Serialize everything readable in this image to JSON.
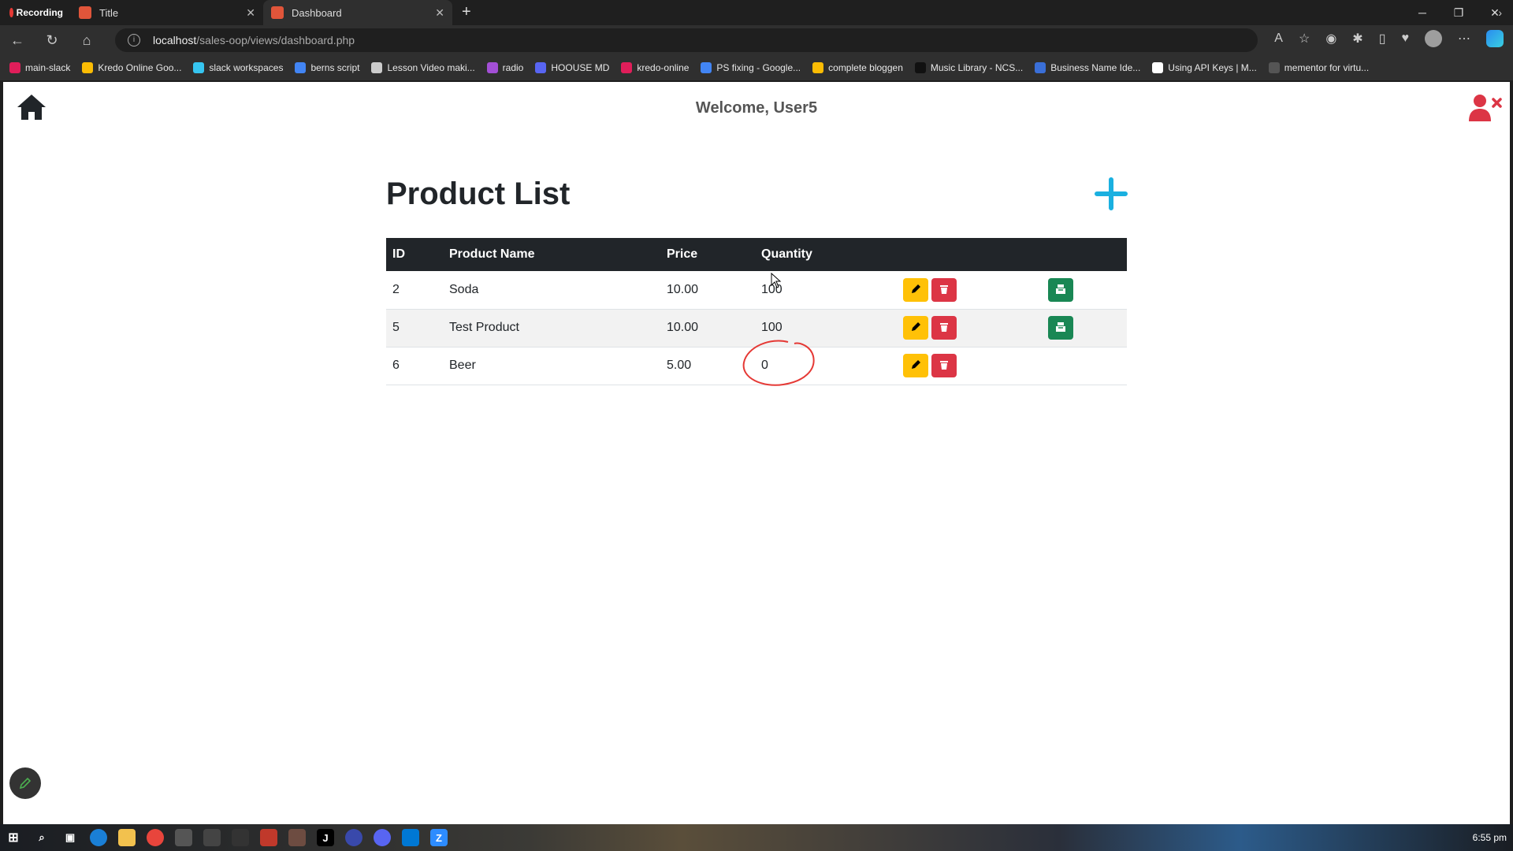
{
  "browser": {
    "recording_label": "Recording",
    "tabs": [
      {
        "title": "Title"
      },
      {
        "title": "Dashboard"
      }
    ],
    "address": {
      "host": "localhost",
      "path": "/sales-oop/views/dashboard.php"
    },
    "bookmarks": [
      {
        "label": "main-slack",
        "color": "#e01e5a"
      },
      {
        "label": "Kredo Online  Goo...",
        "color": "#fbbc04"
      },
      {
        "label": "slack workspaces",
        "color": "#36c5f0"
      },
      {
        "label": "berns script",
        "color": "#4285f4"
      },
      {
        "label": "Lesson Video maki...",
        "color": "#cccccc"
      },
      {
        "label": "radio",
        "color": "#a34fd6"
      },
      {
        "label": "HOOUSE MD",
        "color": "#5865f2"
      },
      {
        "label": "kredo-online",
        "color": "#e01e5a"
      },
      {
        "label": "PS fixing - Google...",
        "color": "#4285f4"
      },
      {
        "label": "complete bloggen",
        "color": "#fbbc04"
      },
      {
        "label": "Music Library - NCS...",
        "color": "#111111"
      },
      {
        "label": "Business Name Ide...",
        "color": "#3a6fd8"
      },
      {
        "label": "Using API Keys | M...",
        "color": "#ffffff"
      },
      {
        "label": "mementor for virtu...",
        "color": "#555555"
      }
    ]
  },
  "header": {
    "welcome": "Welcome, User5"
  },
  "main": {
    "title": "Product List",
    "table": {
      "columns": [
        "ID",
        "Product Name",
        "Price",
        "Quantity"
      ],
      "rows": [
        {
          "id": "2",
          "name": "Soda",
          "price": "10.00",
          "quantity": "100",
          "buy": true
        },
        {
          "id": "5",
          "name": "Test Product",
          "price": "10.00",
          "quantity": "100",
          "buy": true
        },
        {
          "id": "6",
          "name": "Beer",
          "price": "5.00",
          "quantity": "0",
          "buy": false
        }
      ]
    }
  },
  "taskbar": {
    "clock": "6:55 pm"
  },
  "colors": {
    "accent_add": "#1ab0e0",
    "edit": "#ffc107",
    "delete": "#dc3545",
    "buy": "#198754",
    "logout": "#dc3545",
    "annotation": "#e53935"
  }
}
